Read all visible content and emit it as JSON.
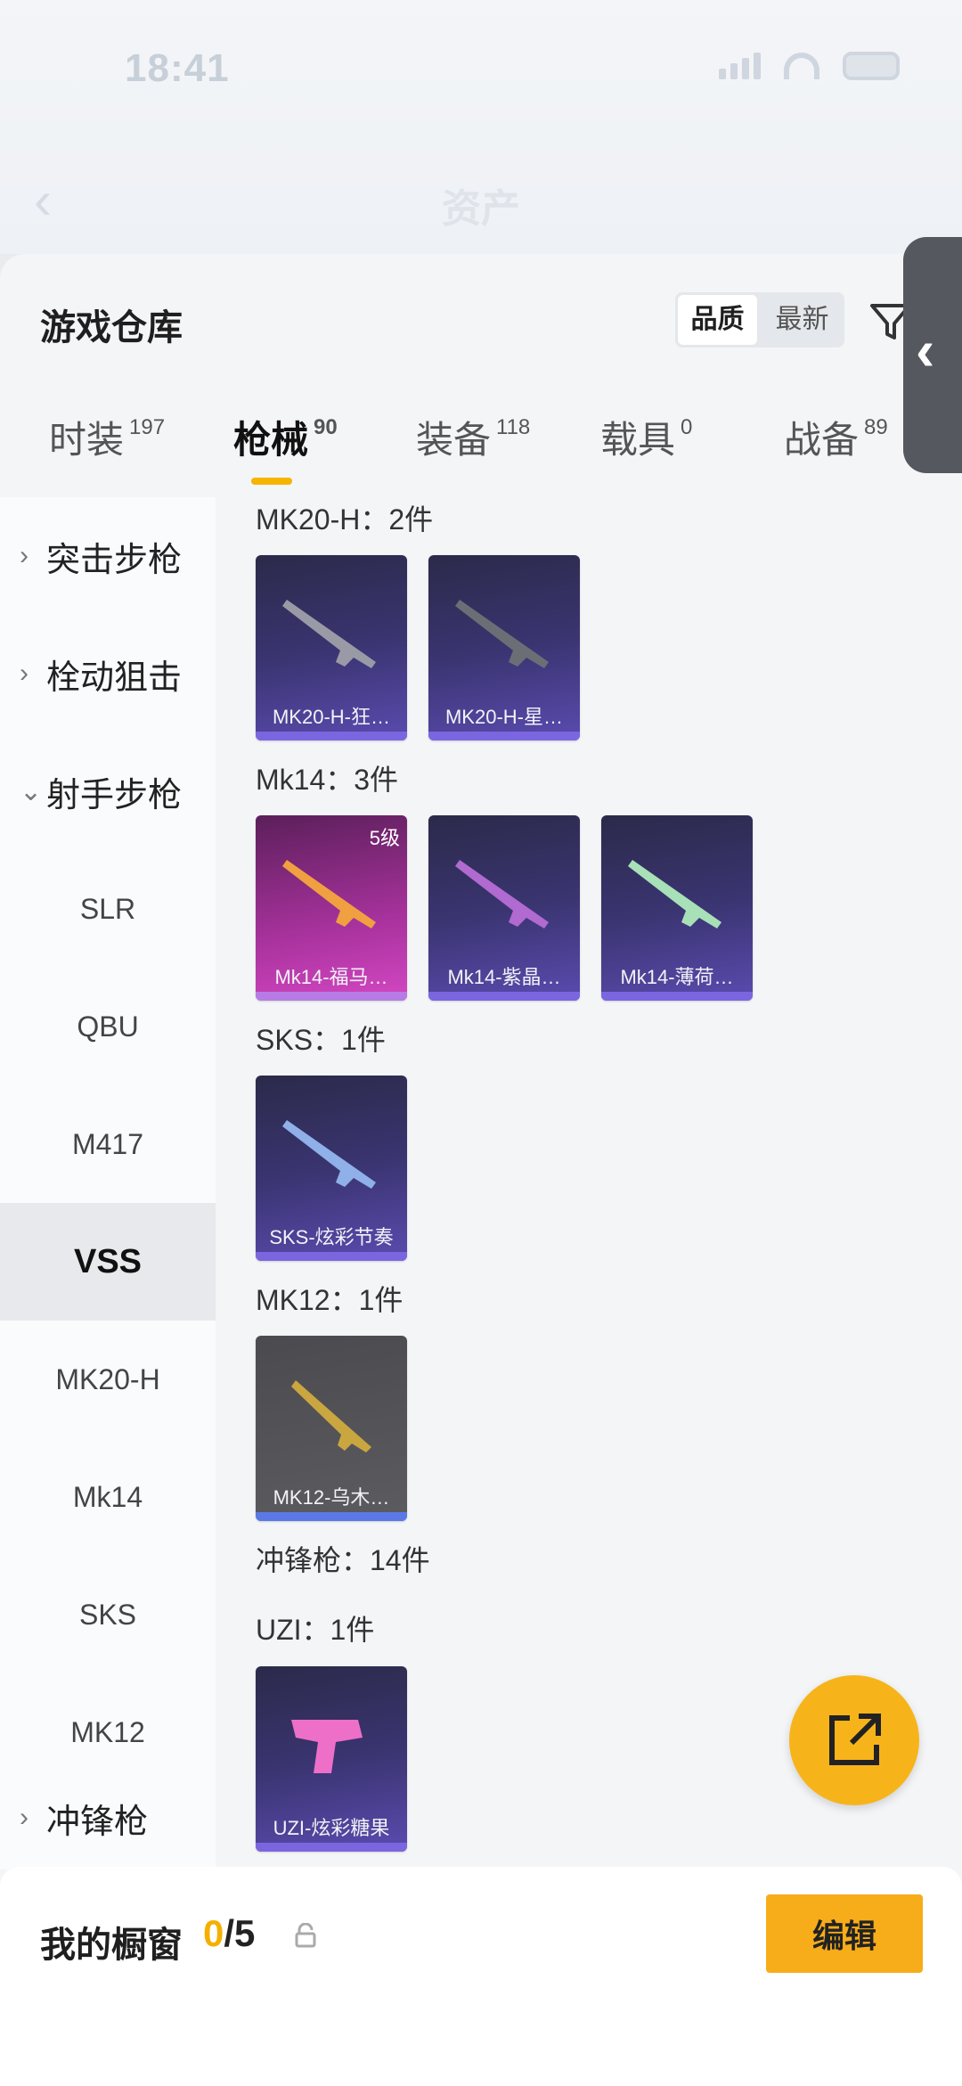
{
  "status": {
    "time": "18:41"
  },
  "nav": {
    "title": "资产"
  },
  "page": {
    "title": "游戏仓库",
    "sort_options": [
      "品质",
      "最新"
    ],
    "active_sort": "品质"
  },
  "tabs": [
    {
      "label": "时装",
      "count": "197"
    },
    {
      "label": "枪械",
      "count": "90"
    },
    {
      "label": "装备",
      "count": "118"
    },
    {
      "label": "载具",
      "count": "0"
    },
    {
      "label": "战备",
      "count": "89"
    }
  ],
  "sidebar": {
    "categories": [
      {
        "label": "突击步枪",
        "arrow": "›"
      },
      {
        "label": "栓动狙击",
        "arrow": "›"
      },
      {
        "label": "射手步枪",
        "arrow": "⌄"
      },
      {
        "label": "冲锋枪",
        "arrow": "›"
      }
    ],
    "subitems": [
      "SLR",
      "QBU",
      "M417",
      "VSS",
      "MK20-H",
      "Mk14",
      "SKS",
      "MK12"
    ],
    "active_sub": "VSS"
  },
  "groups": [
    {
      "title": "MK20-H：2件",
      "items": [
        "MK20-H-狂…",
        "MK20-H-星…"
      ]
    },
    {
      "title": "Mk14：3件",
      "items": [
        "Mk14-福马…",
        "Mk14-紫晶…",
        "Mk14-薄荷…"
      ],
      "level": "5级"
    },
    {
      "title": "SKS：1件",
      "items": [
        "SKS-炫彩节奏"
      ]
    },
    {
      "title": "MK12：1件",
      "items": [
        "MK12-乌木…"
      ]
    },
    {
      "title": "冲锋枪：14件"
    },
    {
      "title": "UZI：1件",
      "items": [
        "UZI-炫彩糖果"
      ]
    }
  ],
  "showcase": {
    "label": "我的橱窗",
    "current": "0",
    "separator": "/5",
    "edit_label": "编辑"
  },
  "colors": {
    "accent": "#f5b400",
    "card_purple": "#3a3470",
    "card_pink": "#a8329d"
  }
}
